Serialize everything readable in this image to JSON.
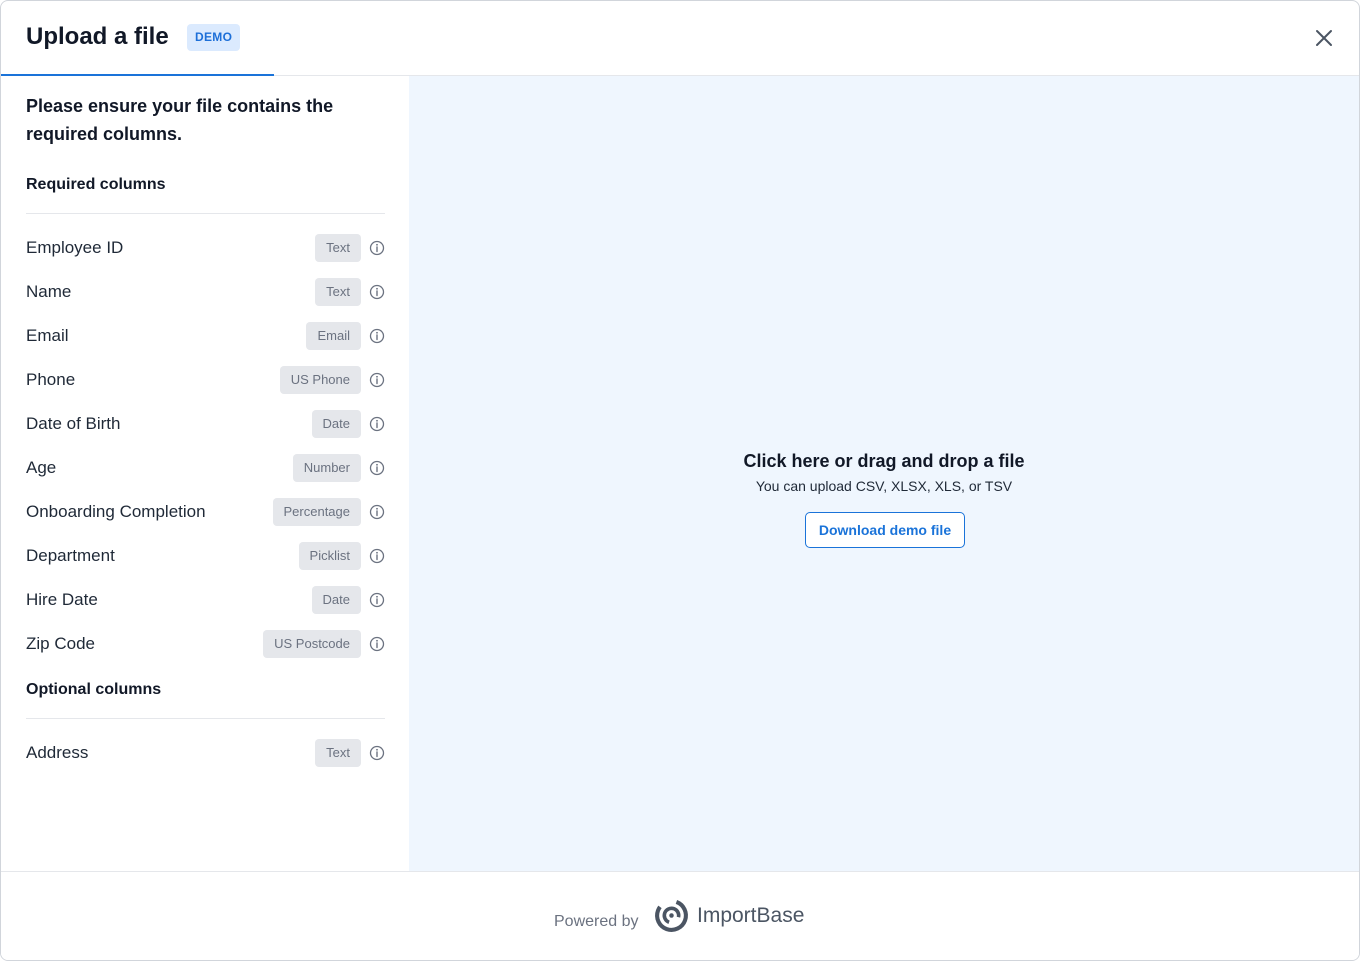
{
  "header": {
    "title": "Upload a file",
    "badge": "DEMO",
    "close_icon": "close-icon"
  },
  "left_panel": {
    "intro": "Please ensure your file contains the required columns.",
    "required_heading": "Required columns",
    "required_columns": [
      {
        "name": "Employee ID",
        "type": "Text"
      },
      {
        "name": "Name",
        "type": "Text"
      },
      {
        "name": "Email",
        "type": "Email"
      },
      {
        "name": "Phone",
        "type": "US Phone"
      },
      {
        "name": "Date of Birth",
        "type": "Date"
      },
      {
        "name": "Age",
        "type": "Number"
      },
      {
        "name": "Onboarding Completion",
        "type": "Percentage"
      },
      {
        "name": "Department",
        "type": "Picklist"
      },
      {
        "name": "Hire Date",
        "type": "Date"
      },
      {
        "name": "Zip Code",
        "type": "US Postcode"
      }
    ],
    "optional_heading": "Optional columns",
    "optional_columns": [
      {
        "name": "Address",
        "type": "Text"
      }
    ],
    "info_icon": "info-icon"
  },
  "dropzone": {
    "title": "Click here or drag and drop a file",
    "subtitle": "You can upload CSV, XLSX, XLS, or TSV",
    "download_button": "Download demo file"
  },
  "footer": {
    "powered_by": "Powered by",
    "brand": "ImportBase"
  },
  "colors": {
    "accent": "#1a73d9",
    "dropzone_bg": "#eff6fe",
    "badge_bg": "#dbeafe",
    "type_chip_bg": "#e5e7eb"
  }
}
